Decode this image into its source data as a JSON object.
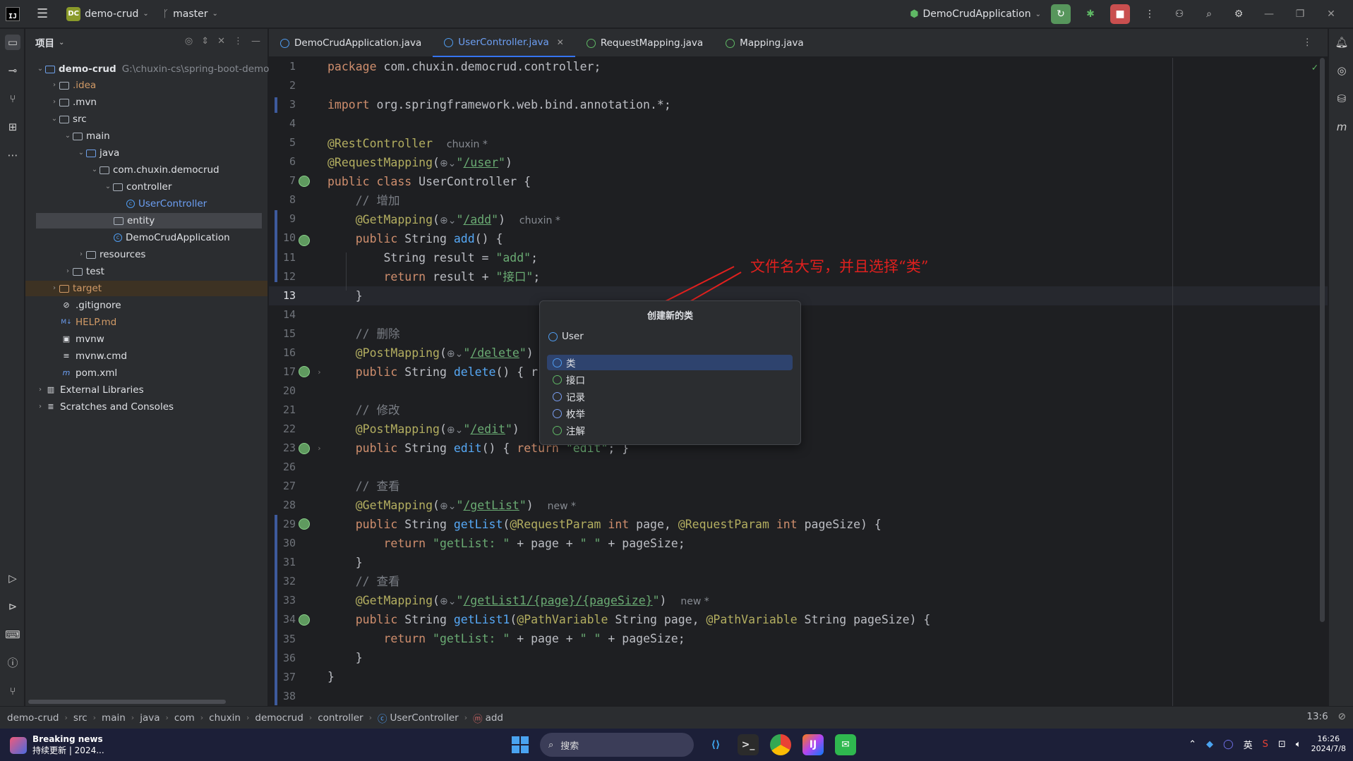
{
  "titlebar": {
    "project_badge": "DC",
    "project_name": "demo-crud",
    "branch": "master",
    "run_config": "DemoCrudApplication"
  },
  "project_panel": {
    "title": "项目",
    "tree": [
      {
        "label": "demo-crud",
        "hint": "G:\\chuxin-cs\\spring-boot-demo\\c"
      },
      {
        "label": ".idea"
      },
      {
        "label": ".mvn"
      },
      {
        "label": "src"
      },
      {
        "label": "main"
      },
      {
        "label": "java"
      },
      {
        "label": "com.chuxin.democrud"
      },
      {
        "label": "controller"
      },
      {
        "label": "UserController"
      },
      {
        "label": "entity"
      },
      {
        "label": "DemoCrudApplication"
      },
      {
        "label": "resources"
      },
      {
        "label": "test"
      },
      {
        "label": "target"
      },
      {
        "label": ".gitignore"
      },
      {
        "label": "HELP.md"
      },
      {
        "label": "mvnw"
      },
      {
        "label": "mvnw.cmd"
      },
      {
        "label": "pom.xml"
      },
      {
        "label": "External Libraries"
      },
      {
        "label": "Scratches and Consoles"
      }
    ]
  },
  "tabs": [
    {
      "label": "DemoCrudApplication.java"
    },
    {
      "label": "UserController.java"
    },
    {
      "label": "RequestMapping.java"
    },
    {
      "label": "Mapping.java"
    }
  ],
  "editor": {
    "line_numbers": [
      "1",
      "2",
      "3",
      "4",
      "5",
      "6",
      "7",
      "8",
      "9",
      "10",
      "11",
      "12",
      "13",
      "14",
      "15",
      "16",
      "17",
      "20",
      "21",
      "22",
      "23",
      "26",
      "27",
      "28",
      "29",
      "30",
      "31",
      "32",
      "33",
      "34",
      "35",
      "36",
      "37",
      "38"
    ],
    "current_line": "13",
    "inlay_author": "chuxin *",
    "inlay_new": "new *"
  },
  "annotation": "文件名大写，并且选择“类”",
  "popup": {
    "title": "创建新的类",
    "input_value": "User",
    "options": [
      "类",
      "接口",
      "记录",
      "枚举",
      "注解"
    ]
  },
  "breadcrumbs": [
    "demo-crud",
    "src",
    "main",
    "java",
    "com",
    "chuxin",
    "democrud",
    "controller",
    "UserController",
    "add"
  ],
  "status": {
    "position": "13:6"
  },
  "taskbar": {
    "news_title": "Breaking news",
    "news_sub": "持续更新 | 2024...",
    "search_placeholder": "搜索",
    "ime": "英",
    "time": "16:26",
    "date": "2024/7/8"
  }
}
